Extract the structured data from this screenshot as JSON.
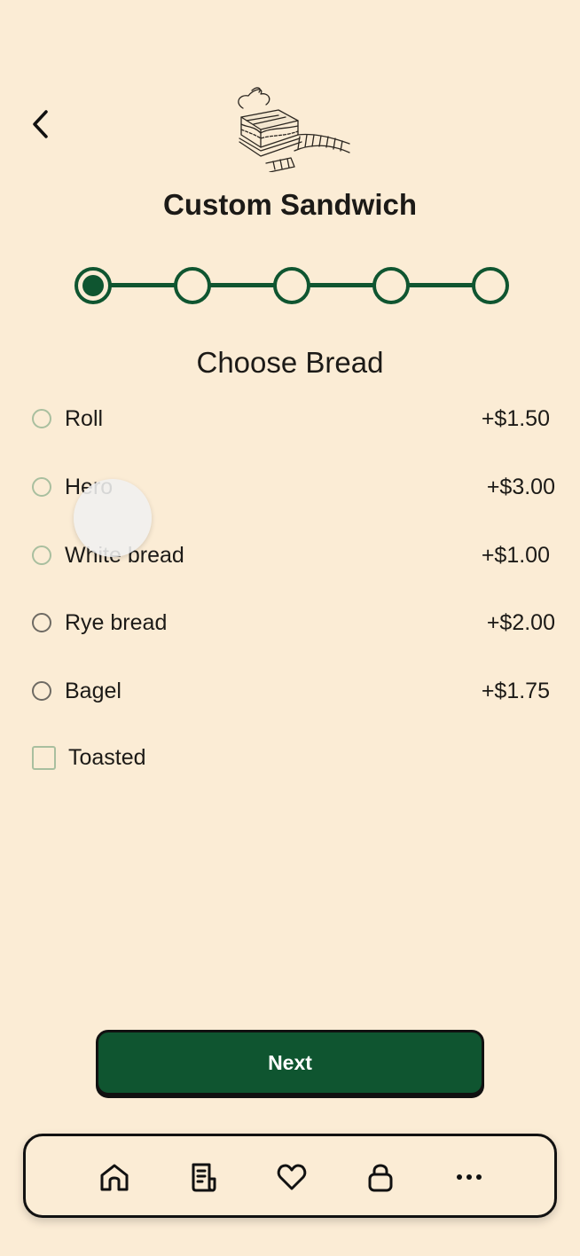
{
  "header": {
    "title": "Custom Sandwich",
    "back_icon": "chevron-left-icon",
    "logo_icon": "sandwich-illustration"
  },
  "stepper": {
    "total_steps": 5,
    "current_step": 1
  },
  "section": {
    "title": "Choose Bread"
  },
  "options": [
    {
      "label": "Roll",
      "price": "+$1.50"
    },
    {
      "label": "Hero",
      "price": "+$3.00"
    },
    {
      "label": "White bread",
      "price": "+$1.00"
    },
    {
      "label": "Rye bread",
      "price": "+$2.00"
    },
    {
      "label": "Bagel",
      "price": "+$1.75"
    }
  ],
  "toasted": {
    "label": "Toasted",
    "checked": false
  },
  "next_button": {
    "label": "Next"
  },
  "tabbar": {
    "items": [
      "home-icon",
      "receipt-icon",
      "heart-icon",
      "lock-icon",
      "more-icon"
    ]
  },
  "colors": {
    "background": "#fbecd5",
    "brand_green": "#0f5530",
    "radio_light": "#a9bf9f",
    "radio_dark": "#6e6a63",
    "text": "#1c1a17"
  }
}
